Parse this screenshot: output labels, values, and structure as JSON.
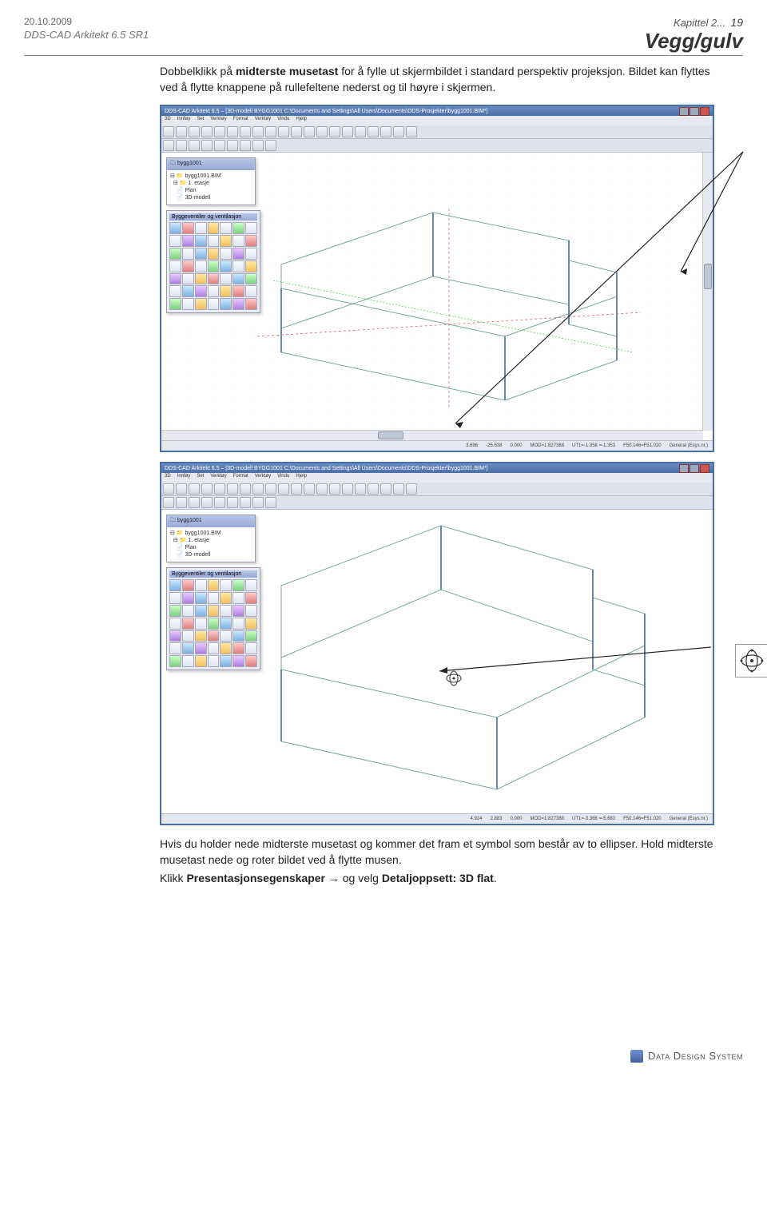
{
  "header": {
    "date": "20.10.2009",
    "product": "DDS-CAD Arkitekt 6.5 SR1",
    "chapter_label": "Kapittel 2...",
    "page_number": "19",
    "section_title": "Vegg/gulv"
  },
  "body": {
    "para1_a": "Dobbelklikk på ",
    "para1_b": "midterste musetast",
    "para1_c": " for å fylle ut skjermbildet i standard perspektiv projeksjon. Bildet kan flyttes ved å flytte knappene på rullefeltene nederst og til høyre i skjermen.",
    "para2": "Hvis du holder nede midterste musetast og kommer det fram et symbol som består av to ellipser. Hold midterste musetast nede og roter bildet ved å flytte musen.",
    "para3_a": "Klikk ",
    "para3_b": "Presentasjonsegenskaper",
    "para3_c": " → og velg ",
    "para3_d": "Detaljoppsett: 3D flat",
    "para3_e": "."
  },
  "screenshot1": {
    "title": "DDS-CAD Arkitekt 6.5 – [3D-modell BYGG1001  C:\\Documents and Settings\\All Users\\Documents\\DDS-Prosjekter\\bygg1001.BIM*]",
    "menu": [
      "3D",
      "Innføy",
      "Set",
      "Verktøy",
      "Format",
      "Verktøy",
      "Vindu",
      "Hjelp"
    ],
    "tree": {
      "root": "bygg1001",
      "items": [
        "bygg1001.BIM",
        "1. etasje",
        "Plan",
        "3D-modell"
      ]
    },
    "palette_title": "Byggeventiler og ventilasjon",
    "status": [
      "3.696",
      "-26.638",
      "0.000",
      "MOD=1:827388",
      "UT1=-1.358 =-1.353",
      "F50.146=F51.020",
      "General (Esys.nr.)"
    ]
  },
  "screenshot2": {
    "title": "DDS-CAD Arkitekt 6.5 – [3D-modell BYGG1001  C:\\Documents and Settings\\All Users\\Documents\\DDS-Prosjekter\\bygg1001.BIM*]",
    "menu": [
      "3D",
      "Innføy",
      "Set",
      "Verktøy",
      "Format",
      "Verktøy",
      "Vindu",
      "Hjelp"
    ],
    "tree": {
      "root": "bygg1001",
      "items": [
        "bygg1001.BIM",
        "1. etasje",
        "Plan",
        "3D-modell"
      ]
    },
    "palette_title": "Byggeventiler og ventilasjon",
    "status": [
      "4.924",
      "2.883",
      "0.000",
      "MOD=1:827388",
      "UT1=-3.366 =-5.683",
      "F50.146=F51.020",
      "General (Esys.nr.)"
    ]
  },
  "icons": {
    "orbit": "orbit-icon"
  },
  "footer": {
    "company": "Data Design System"
  }
}
